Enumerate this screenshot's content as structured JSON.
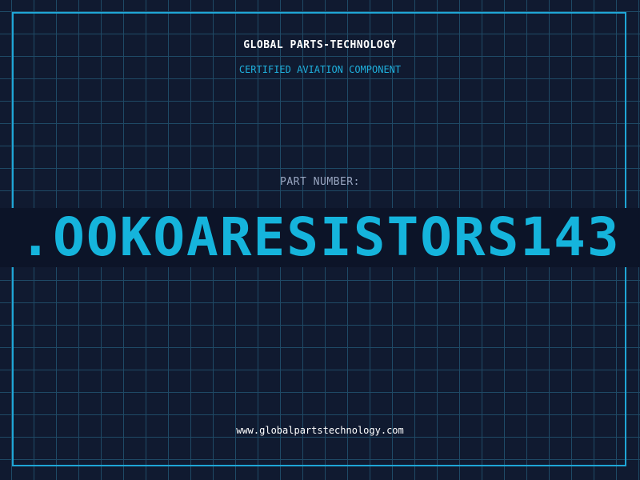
{
  "header": {
    "company": "GLOBAL PARTS-TECHNOLOGY",
    "tagline": "CERTIFIED AVIATION COMPONENT"
  },
  "part": {
    "label": "PART NUMBER:",
    "number": ".OOKOARESISTORS143"
  },
  "footer": {
    "url": "www.globalpartstechnology.com"
  },
  "colors": {
    "background": "#101a30",
    "grid": "#1f4a66",
    "accent": "#1fa6d6",
    "part_number": "#15b4dc"
  }
}
